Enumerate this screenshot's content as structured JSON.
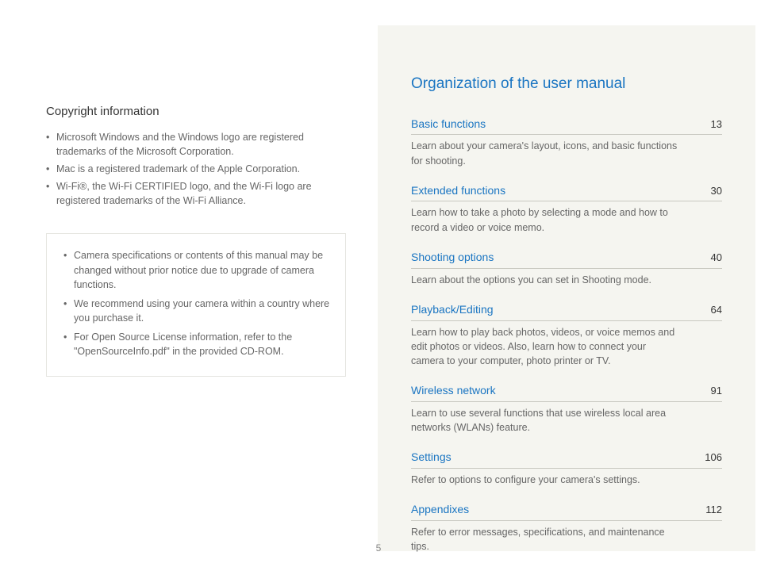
{
  "page_number": "5",
  "left": {
    "heading": "Copyright information",
    "bullets": [
      "Microsoft Windows and the Windows logo are registered trademarks of the Microsoft Corporation.",
      "Mac is a registered trademark of the Apple Corporation.",
      "Wi-Fi®, the Wi-Fi CERTIFIED logo, and the Wi-Fi logo are registered trademarks of the Wi-Fi Alliance."
    ],
    "note_bullets": [
      "Camera specifications or contents of this manual may be changed without prior notice due to upgrade of camera functions.",
      "We recommend using your camera within a country where you purchase it.",
      "For Open Source License information, refer to the \"OpenSourceInfo.pdf\" in the provided CD-ROM."
    ]
  },
  "right": {
    "heading": "Organization of the user manual",
    "entries": [
      {
        "title": "Basic functions",
        "page": "13",
        "desc": "Learn about your camera's layout, icons, and basic functions for shooting."
      },
      {
        "title": "Extended functions",
        "page": "30",
        "desc": "Learn how to take a photo by selecting a mode and how to record a video or voice memo."
      },
      {
        "title": "Shooting options",
        "page": "40",
        "desc": "Learn about the options you can set in Shooting mode."
      },
      {
        "title": "Playback/Editing",
        "page": "64",
        "desc": "Learn how to play back photos, videos, or voice memos and edit photos or videos. Also, learn how to connect your camera to your computer, photo printer or TV."
      },
      {
        "title": "Wireless network",
        "page": "91",
        "desc": "Learn to use several functions that use wireless local area networks (WLANs) feature."
      },
      {
        "title": "Settings",
        "page": "106",
        "desc": "Refer to options to configure your camera's settings."
      },
      {
        "title": "Appendixes",
        "page": "112",
        "desc": "Refer to error messages, specifications, and maintenance tips."
      }
    ]
  }
}
